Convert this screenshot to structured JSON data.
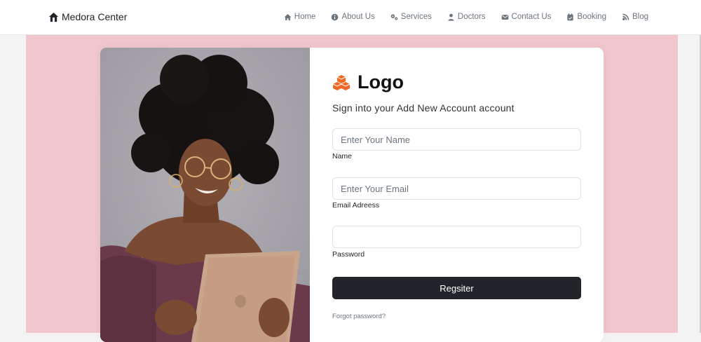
{
  "brand": {
    "name": "Medora Center",
    "icon": "house-icon"
  },
  "nav": [
    {
      "label": "Home",
      "icon": "home-icon"
    },
    {
      "label": "About Us",
      "icon": "info-icon"
    },
    {
      "label": "Services",
      "icon": "gears-icon"
    },
    {
      "label": "Doctors",
      "icon": "doctor-icon"
    },
    {
      "label": "Contact Us",
      "icon": "envelope-icon"
    },
    {
      "label": "Booking",
      "icon": "calendar-icon"
    },
    {
      "label": "Blog",
      "icon": "blog-icon"
    }
  ],
  "form": {
    "logo_text": "Logo",
    "subtitle": "Sign into your Add New Account account",
    "name_placeholder": "Enter Your Name",
    "name_label": "Name",
    "email_placeholder": "Enter Your Email",
    "email_label": "Email Adreess",
    "password_value": "",
    "password_label": "Password",
    "submit_label": "Regsiter",
    "forgot_label": "Forgot password?"
  },
  "colors": {
    "accent": "#f26722",
    "background": "#f1c7cd",
    "button": "#212529"
  }
}
